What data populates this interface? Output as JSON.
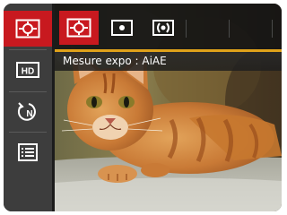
{
  "window": {
    "sidebar": {
      "items": [
        {
          "name": "metering-menu-icon",
          "active": true
        },
        {
          "name": "hd-video-icon",
          "active": false,
          "label": "HD"
        },
        {
          "name": "timer-n-icon",
          "active": false,
          "label": "N"
        },
        {
          "name": "menu-list-icon",
          "active": false
        }
      ]
    },
    "topbar": {
      "items": [
        {
          "name": "aiae-metering-icon",
          "active": true
        },
        {
          "name": "spot-metering-icon",
          "active": false
        },
        {
          "name": "center-weighted-metering-icon",
          "active": false
        }
      ]
    },
    "label": "Mesure expo : AiAE"
  },
  "colors": {
    "accent": "#c8191f",
    "highlight": "#e0a21a",
    "sidebar_bg": "#3d3d3d",
    "topbar_bg": "#141414"
  }
}
